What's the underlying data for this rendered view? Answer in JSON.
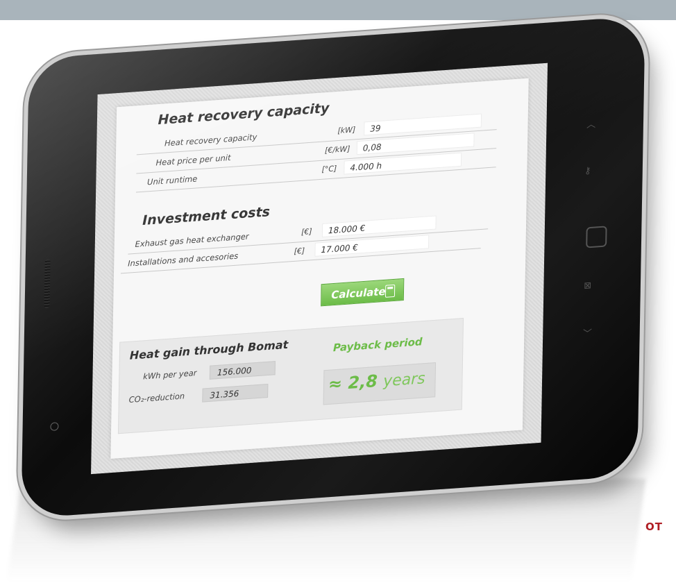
{
  "brand": "OT",
  "section1": {
    "title": "Heat recovery capacity",
    "rows": [
      {
        "label": "Heat recovery capacity",
        "unit": "[kW]",
        "value": "39"
      },
      {
        "label": "Heat price per unit",
        "unit": "[€/kW]",
        "value": "0,08"
      },
      {
        "label": "Unit runtime",
        "unit": "[°C]",
        "value": "4.000 h"
      }
    ]
  },
  "section2": {
    "title": "Investment costs",
    "rows": [
      {
        "label": "Exhaust gas heat exchanger",
        "unit": "[€]",
        "value": "18.000 €"
      },
      {
        "label": "Installations and accesories",
        "unit": "[€]",
        "value": "17.000 €"
      }
    ]
  },
  "calculate_button": {
    "label": "Calculate",
    "icon": "calculator-icon"
  },
  "results": {
    "title": "Heat gain through Bomat",
    "kwh_label": "kWh per year",
    "kwh_value": "156.000",
    "co2_label": "CO₂-reduction",
    "co2_value": "31.356",
    "payback_label": "Payback period",
    "payback_value": "≈ 2,8",
    "payback_unit": "years"
  },
  "colors": {
    "accent": "#6cbc48",
    "brand": "#b01e24",
    "top_band": "#a9b4bb"
  }
}
